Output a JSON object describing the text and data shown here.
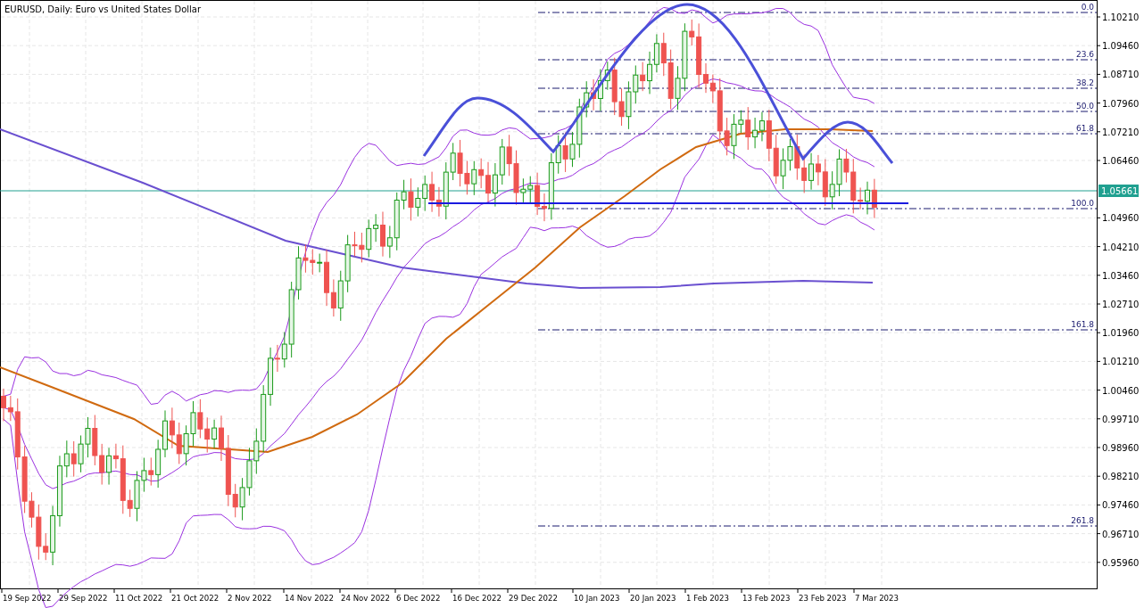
{
  "chart": {
    "title": "EURUSD, Daily:  Euro vs United States Dollar",
    "price_tag": "1.05661",
    "y_axis": [
      "1.10210",
      "1.09460",
      "1.08710",
      "1.07960",
      "1.07210",
      "1.06460",
      "1.04960",
      "1.04210",
      "1.03460",
      "1.02710",
      "1.01960",
      "1.01210",
      "1.00460",
      "0.99710",
      "0.98960",
      "0.98210",
      "0.97460",
      "0.96710",
      "0.95960"
    ],
    "x_axis": [
      "19 Sep 2022",
      "29 Sep 2022",
      "11 Oct 2022",
      "21 Oct 2022",
      "2 Nov 2022",
      "14 Nov 2022",
      "24 Nov 2022",
      "6 Dec 2022",
      "16 Dec 2022",
      "29 Dec 2022",
      "10 Jan 2023",
      "20 Jan 2023",
      "1 Feb 2023",
      "13 Feb 2023",
      "23 Feb 2023",
      "7 Mar 2023"
    ],
    "fibonacci": [
      "0.0",
      "23.6",
      "38.2",
      "50.0",
      "61.8",
      "100.0",
      "161.8",
      "261.8"
    ]
  }
}
